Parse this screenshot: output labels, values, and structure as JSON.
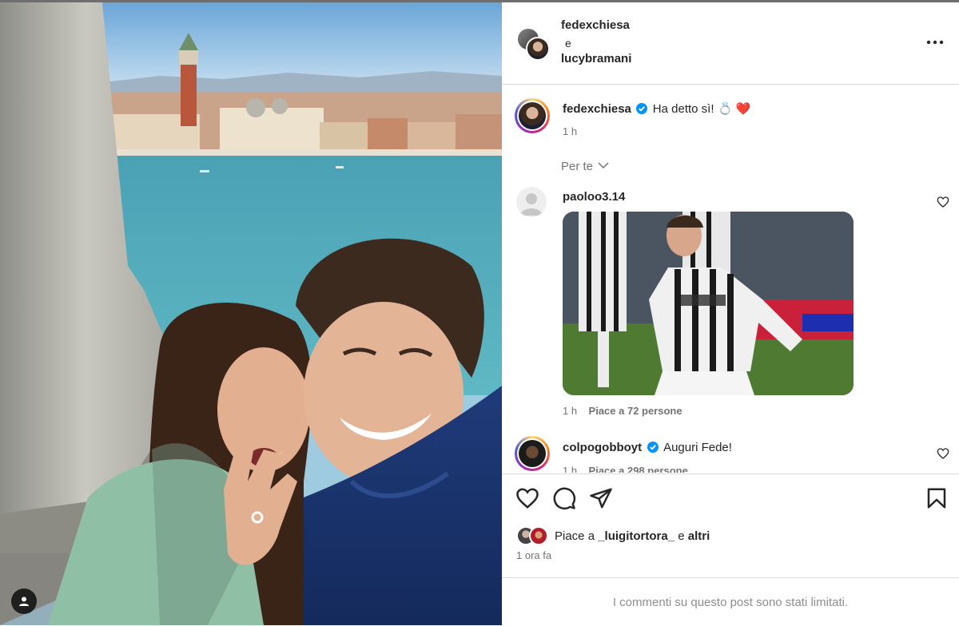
{
  "header": {
    "user1": "fedexchiesa",
    "conjunction": "e",
    "user2": "lucybramani",
    "more_icon": "more-horizontal-icon"
  },
  "caption": {
    "username": "fedexchiesa",
    "text": "Ha detto sì!",
    "emojis": "💍 ❤️",
    "time": "1 h"
  },
  "filter": {
    "label": "Per te"
  },
  "comments": [
    {
      "username": "paoloo3.14",
      "text": "",
      "time": "1 h",
      "likes": "Piace a 72 persone",
      "has_gif": true
    },
    {
      "username": "colpogobboyt",
      "text": "Auguri Fede!",
      "time": "1 h",
      "likes": "Piace a 298 persone",
      "verified": true
    }
  ],
  "actions": {
    "icons": [
      "heart-icon",
      "comment-icon",
      "share-icon",
      "bookmark-icon"
    ],
    "likes_prefix": "Piace a",
    "likes_user": "_luigitortora_",
    "likes_suffix": "e",
    "likes_others": "altri",
    "time_ago": "1 ora fa"
  },
  "footer": {
    "limited_text": "I commenti su questo post sono stati limitati."
  },
  "colors": {
    "accent_blue": "#0095f6",
    "heart_red": "#ed4956",
    "text_primary": "#262626",
    "text_secondary": "#737373",
    "border": "#dbdbdb"
  }
}
